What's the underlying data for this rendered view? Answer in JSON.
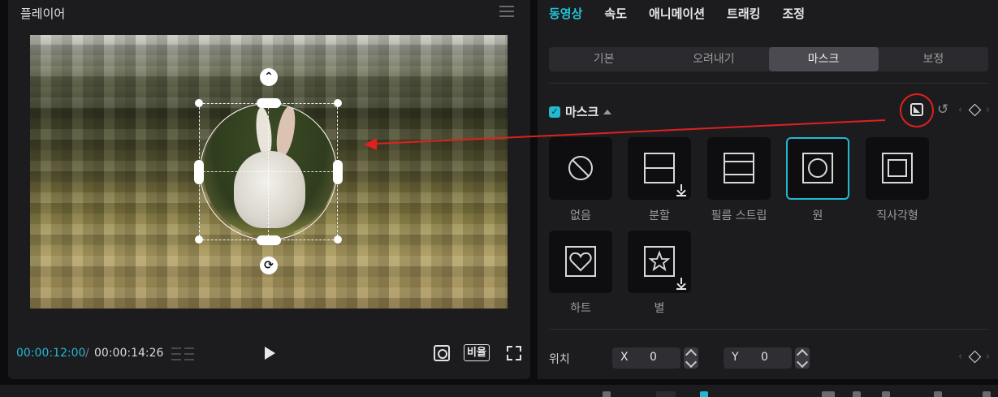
{
  "player": {
    "title": "플레이어",
    "time_current": "00:00:12:00",
    "time_separator": "/",
    "time_total": "00:00:14:26",
    "ratio_label": "비율"
  },
  "panel": {
    "tabs": [
      {
        "label": "동영상",
        "active": true
      },
      {
        "label": "속도",
        "active": false
      },
      {
        "label": "애니메이션",
        "active": false
      },
      {
        "label": "트래킹",
        "active": false
      },
      {
        "label": "조정",
        "active": false
      }
    ],
    "subtabs": [
      {
        "label": "기본",
        "active": false
      },
      {
        "label": "오려내기",
        "active": false
      },
      {
        "label": "마스크",
        "active": true
      },
      {
        "label": "보정",
        "active": false
      }
    ],
    "mask": {
      "label": "마스크",
      "checked": true,
      "options": [
        {
          "label": "없음",
          "icon": "none-icon",
          "download": false,
          "selected": false
        },
        {
          "label": "분할",
          "icon": "split-icon",
          "download": true,
          "selected": false
        },
        {
          "label": "필름 스트립",
          "icon": "film-strip-icon",
          "download": false,
          "selected": false
        },
        {
          "label": "원",
          "icon": "circle-mask-icon",
          "download": false,
          "selected": true
        },
        {
          "label": "직사각형",
          "icon": "rectangle-mask-icon",
          "download": false,
          "selected": false
        },
        {
          "label": "하트",
          "icon": "heart-mask-icon",
          "download": false,
          "selected": false
        },
        {
          "label": "별",
          "icon": "star-mask-icon",
          "download": true,
          "selected": false
        }
      ]
    },
    "position": {
      "label": "위치",
      "x_label": "X",
      "x_value": "0",
      "y_label": "Y",
      "y_value": "0"
    }
  },
  "colors": {
    "accent": "#22b8d0",
    "annotation": "#e02020"
  }
}
